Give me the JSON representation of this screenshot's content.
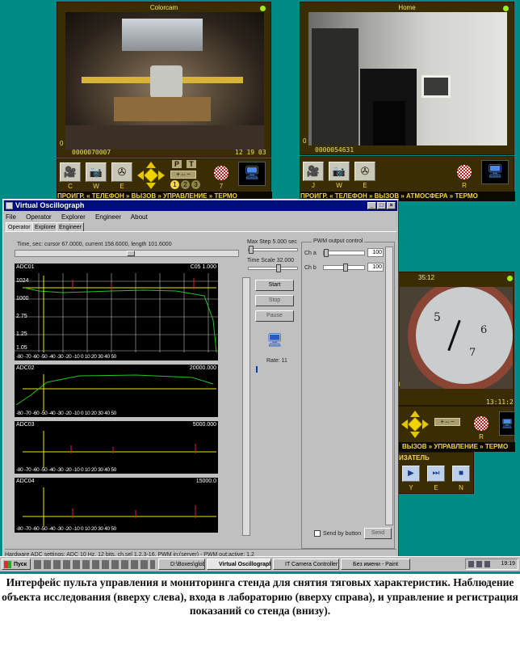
{
  "camera_left": {
    "title": "Colorcam",
    "footer_left": "0000070007",
    "footer_right": "12 19 03",
    "zero": "0"
  },
  "camera_right": {
    "title": "Home",
    "footer_left": "0000054631",
    "zero": "0"
  },
  "camera_mid": {
    "title": "35:12",
    "footer_right": "13:11:2",
    "zero": "0"
  },
  "control_left": {
    "buttons": [
      {
        "icon": "🎥",
        "label": "С"
      },
      {
        "icon": "📷",
        "label": "W"
      },
      {
        "icon": "✇",
        "label": "Е"
      }
    ],
    "pt_labels": [
      "P",
      "T"
    ],
    "circle_labels": [
      "1",
      "2",
      "3"
    ],
    "target_label": "7",
    "tabs": "ПРОИГР. « ТЕЛЕФОН » ВЫЗОВ » УПРАВЛЕНИЕ » ТЕРМО"
  },
  "control_right": {
    "buttons": [
      {
        "icon": "🎥",
        "label": "J"
      },
      {
        "icon": "📷",
        "label": "W"
      },
      {
        "icon": "✇",
        "label": "E"
      }
    ],
    "target_label": "R",
    "tabs": "ПРОИГР. « ТЕЛЕФОН » ВЫЗОВ » АТМОСФЕРА » ТЕРМО"
  },
  "control_mid": {
    "target_label": "R",
    "tabs": "ВЫЗОВ » УПРАВЛЕНИЕ » ТЕРМО",
    "player_title": "ИЗАТЕЛЬ",
    "player_buttons": [
      {
        "icon": "▶",
        "label": "Y"
      },
      {
        "icon": "⏭",
        "label": "E"
      },
      {
        "icon": "■",
        "label": "N"
      }
    ]
  },
  "oscillograph": {
    "title": "Virtual Oscillograph",
    "menu": [
      "File",
      "Operator",
      "Explorer",
      "Engineer",
      "About"
    ],
    "tabs": [
      "Operator",
      "Explorer",
      "Engineer"
    ],
    "status_line": "Time, sec: cursor 67.0000, current 158.6000, length 101.6000",
    "max_step": "Max Step 5.000 sec",
    "time_scale": "Time Scale 32.000",
    "channels": [
      {
        "name": "ADC01",
        "value": "C05 1.000"
      },
      {
        "name": "ADC02",
        "value": "20000.000"
      },
      {
        "name": "ADC03",
        "value": "5000.000"
      },
      {
        "name": "ADC04",
        "value": "15000.0"
      }
    ],
    "y_ticks": [
      "1024",
      "1000",
      "2.75",
      "1.25",
      "1.05"
    ],
    "x_ticks": "-80 -70 -60 -50 -40 -30 -20 -10 0 10 20 30 40 50",
    "buttons": [
      "Start",
      "Stop",
      "Pause"
    ],
    "rate_label": "Rate: 11",
    "pwm_title": "PWM output control",
    "pwm_rows": [
      {
        "label": "Ch a",
        "value": "100"
      },
      {
        "label": "Ch b",
        "value": "100"
      }
    ],
    "send_label": "Send by button",
    "send_button": "Send",
    "hardware_status": "Hardware ADC settings: ADC 10 Hz, 12 bits, ch.sel 1,2,3-16, PWM in:(server) - PWM out:active: 1,2"
  },
  "taskbar": {
    "start": "Пуск",
    "tasks": [
      "D:\\Boxes\\global\\...",
      "Virtual Oscillograph",
      "IT Camera Controller",
      "Без имени - Paint"
    ],
    "clock": "19:19"
  },
  "caption": "Интерфейс пульта управления и мониторинга стенда для снятия тяговых характеристик. Наблюдение объекта исследования (вверху слева), входа в лабораторию (вверху справа), и управление и регистрация показаний со стенда (внизу).",
  "colors": {
    "desktop": "#008a86",
    "panel": "#3a2d04",
    "accent_yellow": "#f4d44a",
    "trace_yellow": "#e8e800",
    "trace_green": "#22c322",
    "trace_red": "#e02020",
    "title_bar": "#000e7b"
  }
}
